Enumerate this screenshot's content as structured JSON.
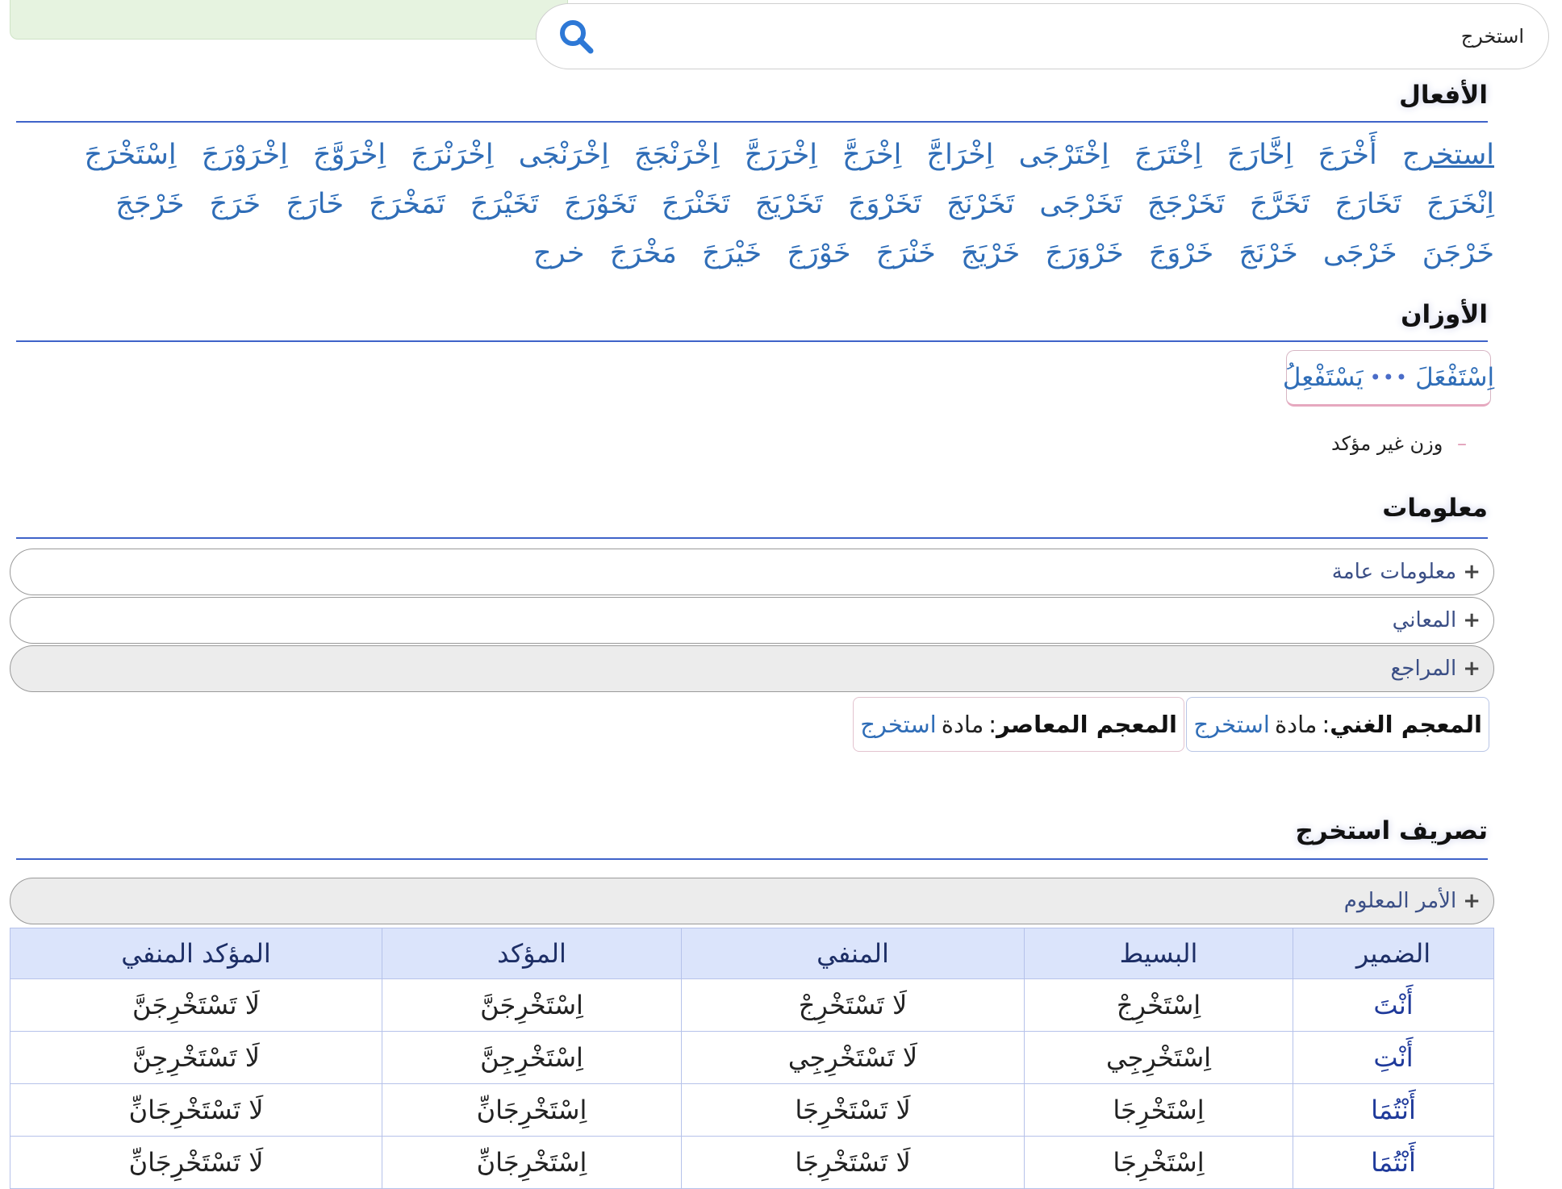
{
  "search": {
    "value": "استخرج"
  },
  "sections": {
    "verbs_title": "الأفعال",
    "awzan_title": "الأوزان",
    "info_title": "معلومات",
    "conj_title": "تصريف استخرج"
  },
  "verbs": [
    "استخرج",
    "أَخْرَجَ",
    "اِخَّارَجَ",
    "اِخْتَرَجَ",
    "اِخْتَرْجَى",
    "اِخْرَاجَّ",
    "اِخْرَجَّ",
    "اِخْرَرَجَّ",
    "اِخْرَنْجَجَ",
    "اِخْرَنْجَى",
    "اِخْرَنْرَجَ",
    "اِخْرَوَّجَ",
    "اِخْرَوْرَجَ",
    "اِسْتَخْرَجَ",
    "اِنْخَرَجَ",
    "تَخَارَجَ",
    "تَخَرَّجَ",
    "تَخَرْجَجَ",
    "تَخَرْجَى",
    "تَخَرْنَجَ",
    "تَخَرْوَجَ",
    "تَخَرْيَجَ",
    "تَخَنْرَجَ",
    "تَخَوْرَجَ",
    "تَخَيْرَجَ",
    "تَمَخْرَجَ",
    "خَارَجَ",
    "خَرَجَ",
    "خَرْجَجَ",
    "خَرْجَنَ",
    "خَرْجَى",
    "خَرْنَجَ",
    "خَرْوَجَ",
    "خَرْوَرَجَ",
    "خَرْيَجَ",
    "خَنْرَجَ",
    "خَوْرَجَ",
    "خَيْرَجَ",
    "مَخْرَجَ",
    "خرج"
  ],
  "wazn": {
    "past": "اِسْتَفْعَلَ",
    "separator": "•••",
    "present": "يَسْتَفْعِلُ"
  },
  "note": {
    "dash": "–",
    "text": "وزن غير مؤكد"
  },
  "accordions": [
    {
      "plus": "+",
      "label": "معلومات عامة"
    },
    {
      "plus": "+",
      "label": "المعاني"
    },
    {
      "plus": "+",
      "label": "المراجع"
    }
  ],
  "dictionaries": [
    {
      "name": "المعجم الغني",
      "colon": ":",
      "prefix": "مادة",
      "word": "استخرج"
    },
    {
      "name": "المعجم المعاصر",
      "colon": ":",
      "prefix": "مادة",
      "word": "استخرج"
    }
  ],
  "imperative": {
    "plus": "+",
    "label": "الأمر المعلوم"
  },
  "table": {
    "headers": [
      "الضمير",
      "البسيط",
      "المنفي",
      "المؤكد",
      "المؤكد المنفي"
    ],
    "rows": [
      [
        "أَنْتَ",
        "اِسْتَخْرِجْ",
        "لَا تَسْتَخْرِجْ",
        "اِسْتَخْرِجَنَّ",
        "لَا تَسْتَخْرِجَنَّ"
      ],
      [
        "أَنْتِ",
        "اِسْتَخْرِجِي",
        "لَا تَسْتَخْرِجِي",
        "اِسْتَخْرِجِنَّ",
        "لَا تَسْتَخْرِجِنَّ"
      ],
      [
        "أَنْتُمَا",
        "اِسْتَخْرِجَا",
        "لَا تَسْتَخْرِجَا",
        "اِسْتَخْرِجَانِّ",
        "لَا تَسْتَخْرِجَانِّ"
      ],
      [
        "أَنْتُمَا",
        "اِسْتَخْرِجَا",
        "لَا تَسْتَخْرِجَا",
        "اِسْتَخْرِجَانِّ",
        "لَا تَسْتَخْرِجَانِّ"
      ]
    ]
  }
}
